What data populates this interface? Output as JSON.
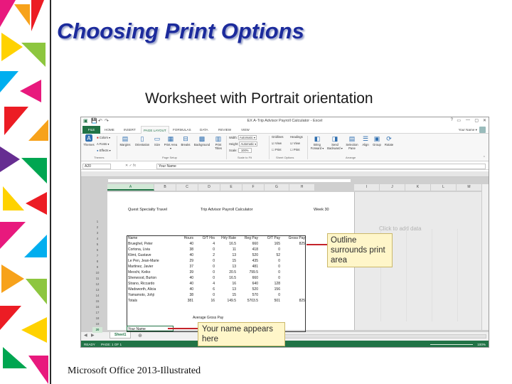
{
  "slide": {
    "title": "Choosing Print Options",
    "subtitle": "Worksheet with Portrait orientation",
    "footer": "Microsoft Office 2013-Illustrated"
  },
  "excel": {
    "window_title": "EX A-Trip Advisor Payroll Calculator - Excel",
    "window_controls": [
      "?",
      "▭",
      "—",
      "▢",
      "✕"
    ],
    "tabs": [
      "FILE",
      "HOME",
      "INSERT",
      "PAGE LAYOUT",
      "FORMULAS",
      "DATA",
      "REVIEW",
      "VIEW"
    ],
    "active_tab": "PAGE LAYOUT",
    "user": "Your Name ▾",
    "ribbon": {
      "themes": [
        "Themes",
        "Colors ▾",
        "Fonts ▾",
        "Effects ▾"
      ],
      "page_setup_buttons": [
        "Margins",
        "Orientation",
        "Size",
        "Print Area ▾",
        "Breaks",
        "Background",
        "Print Titles"
      ],
      "scale": {
        "width_label": "Width:",
        "width_value": "Automatic ▾",
        "height_label": "Height:",
        "height_value": "Automatic ▾",
        "scale_label": "Scale:",
        "scale_value": "100%"
      },
      "sheet_options": {
        "gridlines": "Gridlines",
        "headings": "Headings",
        "view": "View",
        "print": "Print"
      },
      "arrange_buttons": [
        "Bring Forward ▾",
        "Send Backward ▾",
        "Selection Pane",
        "Align",
        "Group",
        "Rotate"
      ],
      "groups": [
        "Themes",
        "Page Setup",
        "Scale to Fit",
        "Sheet Options",
        "Arrange"
      ]
    },
    "name_box": "A20",
    "formula_icons": "✕ ✓ fx",
    "formula_value": "Your Name",
    "columns_left": [
      "A",
      "B",
      "C",
      "D",
      "E",
      "F",
      "G",
      "H"
    ],
    "columns_right": [
      "I",
      "J",
      "K",
      "L",
      "M"
    ],
    "active_column": "A",
    "rows": [
      "1",
      "2",
      "3",
      "4",
      "5",
      "6",
      "7",
      "8",
      "9",
      "10",
      "11",
      "12",
      "13",
      "14",
      "15",
      "16",
      "17",
      "18",
      "19",
      "20"
    ],
    "active_row": "20",
    "sheet": {
      "company": "Quest Specialty Travel",
      "report": "Trip Advisor Payroll Calculator",
      "period": "Week 30",
      "headers": [
        "Name",
        "Hours",
        "O/T Hrs",
        "Hrly Rate",
        "Reg Pay",
        "O/T Pay",
        "Gross Pay"
      ],
      "data": [
        [
          "Brueghel, Peter",
          "40",
          "4",
          "16.5",
          "660",
          "165",
          "825"
        ],
        [
          "Cortona, Livia",
          "38",
          "0",
          "11",
          "418",
          "0",
          ""
        ],
        [
          "Klimt, Gustave",
          "40",
          "2",
          "13",
          "520",
          "52",
          ""
        ],
        [
          "Le Pen, Jean-Marie",
          "29",
          "0",
          "15",
          "435",
          "0",
          ""
        ],
        [
          "Martinez, Javier",
          "37",
          "0",
          "13",
          "481",
          "0",
          ""
        ],
        [
          "Meochi, Keiko",
          "39",
          "0",
          "20.5",
          "799.5",
          "0",
          ""
        ],
        [
          "Sherwood, Burton",
          "40",
          "0",
          "16.5",
          "660",
          "0",
          ""
        ],
        [
          "Strano, Riccardo",
          "40",
          "4",
          "16",
          "640",
          "128",
          ""
        ],
        [
          "Wadsworth, Alicia",
          "40",
          "6",
          "13",
          "520",
          "156",
          ""
        ],
        [
          "Yamamoto, Johji",
          "38",
          "0",
          "15",
          "570",
          "0",
          ""
        ]
      ],
      "totals": [
        "Totals",
        "381",
        "16",
        "149.5",
        "5703.5",
        "501",
        "825"
      ],
      "avg_label": "Average Gross Pay",
      "your_name": "Your Name",
      "click_hint": "Click to add data"
    },
    "sheet_tab": "Sheet1",
    "sheet_add": "⊕",
    "status_left": "READY",
    "status_page": "PAGE: 1 OF 1",
    "zoom": "100%"
  },
  "callouts": {
    "outline": "Outline surrounds print area",
    "name": "Your name appears here"
  },
  "colors": {
    "title": "#1c2b9c",
    "excel_green": "#217346",
    "callout_bg": "#fff6c9",
    "arrow": "#c4232a"
  }
}
